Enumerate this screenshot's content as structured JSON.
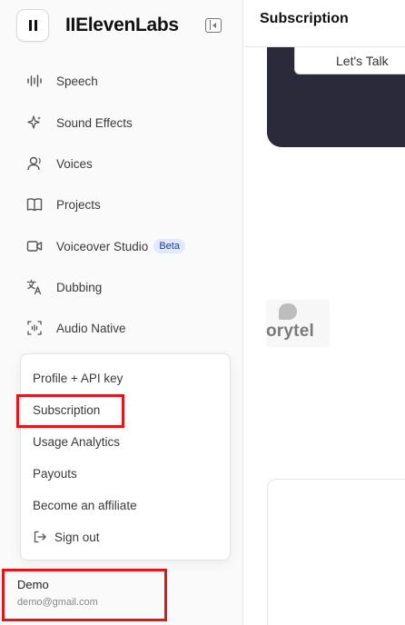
{
  "app": {
    "brand": "IIElevenLabs"
  },
  "nav": {
    "items": [
      {
        "label": "Speech",
        "icon": "waveform-icon"
      },
      {
        "label": "Sound Effects",
        "icon": "sparkles-icon"
      },
      {
        "label": "Voices",
        "icon": "user-voice-icon"
      },
      {
        "label": "Projects",
        "icon": "book-icon"
      },
      {
        "label": "Voiceover Studio",
        "icon": "video-camera-icon",
        "badge": "Beta"
      },
      {
        "label": "Dubbing",
        "icon": "translate-icon"
      },
      {
        "label": "Audio Native",
        "icon": "audio-native-icon"
      }
    ]
  },
  "menu": {
    "items": [
      {
        "label": "Profile + API key"
      },
      {
        "label": "Subscription"
      },
      {
        "label": "Usage Analytics"
      },
      {
        "label": "Payouts"
      },
      {
        "label": "Become an affiliate"
      },
      {
        "label": "Sign out",
        "icon": "sign-out-icon"
      }
    ]
  },
  "user": {
    "name": "Demo",
    "email": "demo@gmail.com"
  },
  "main": {
    "title": "Subscription",
    "cta_label": "Let's Talk",
    "partner_logo_text": "orytel"
  },
  "colors": {
    "highlight": "#e0161b",
    "dark_card": "#2b2a3a",
    "beta_bg": "#dfe9ff"
  }
}
